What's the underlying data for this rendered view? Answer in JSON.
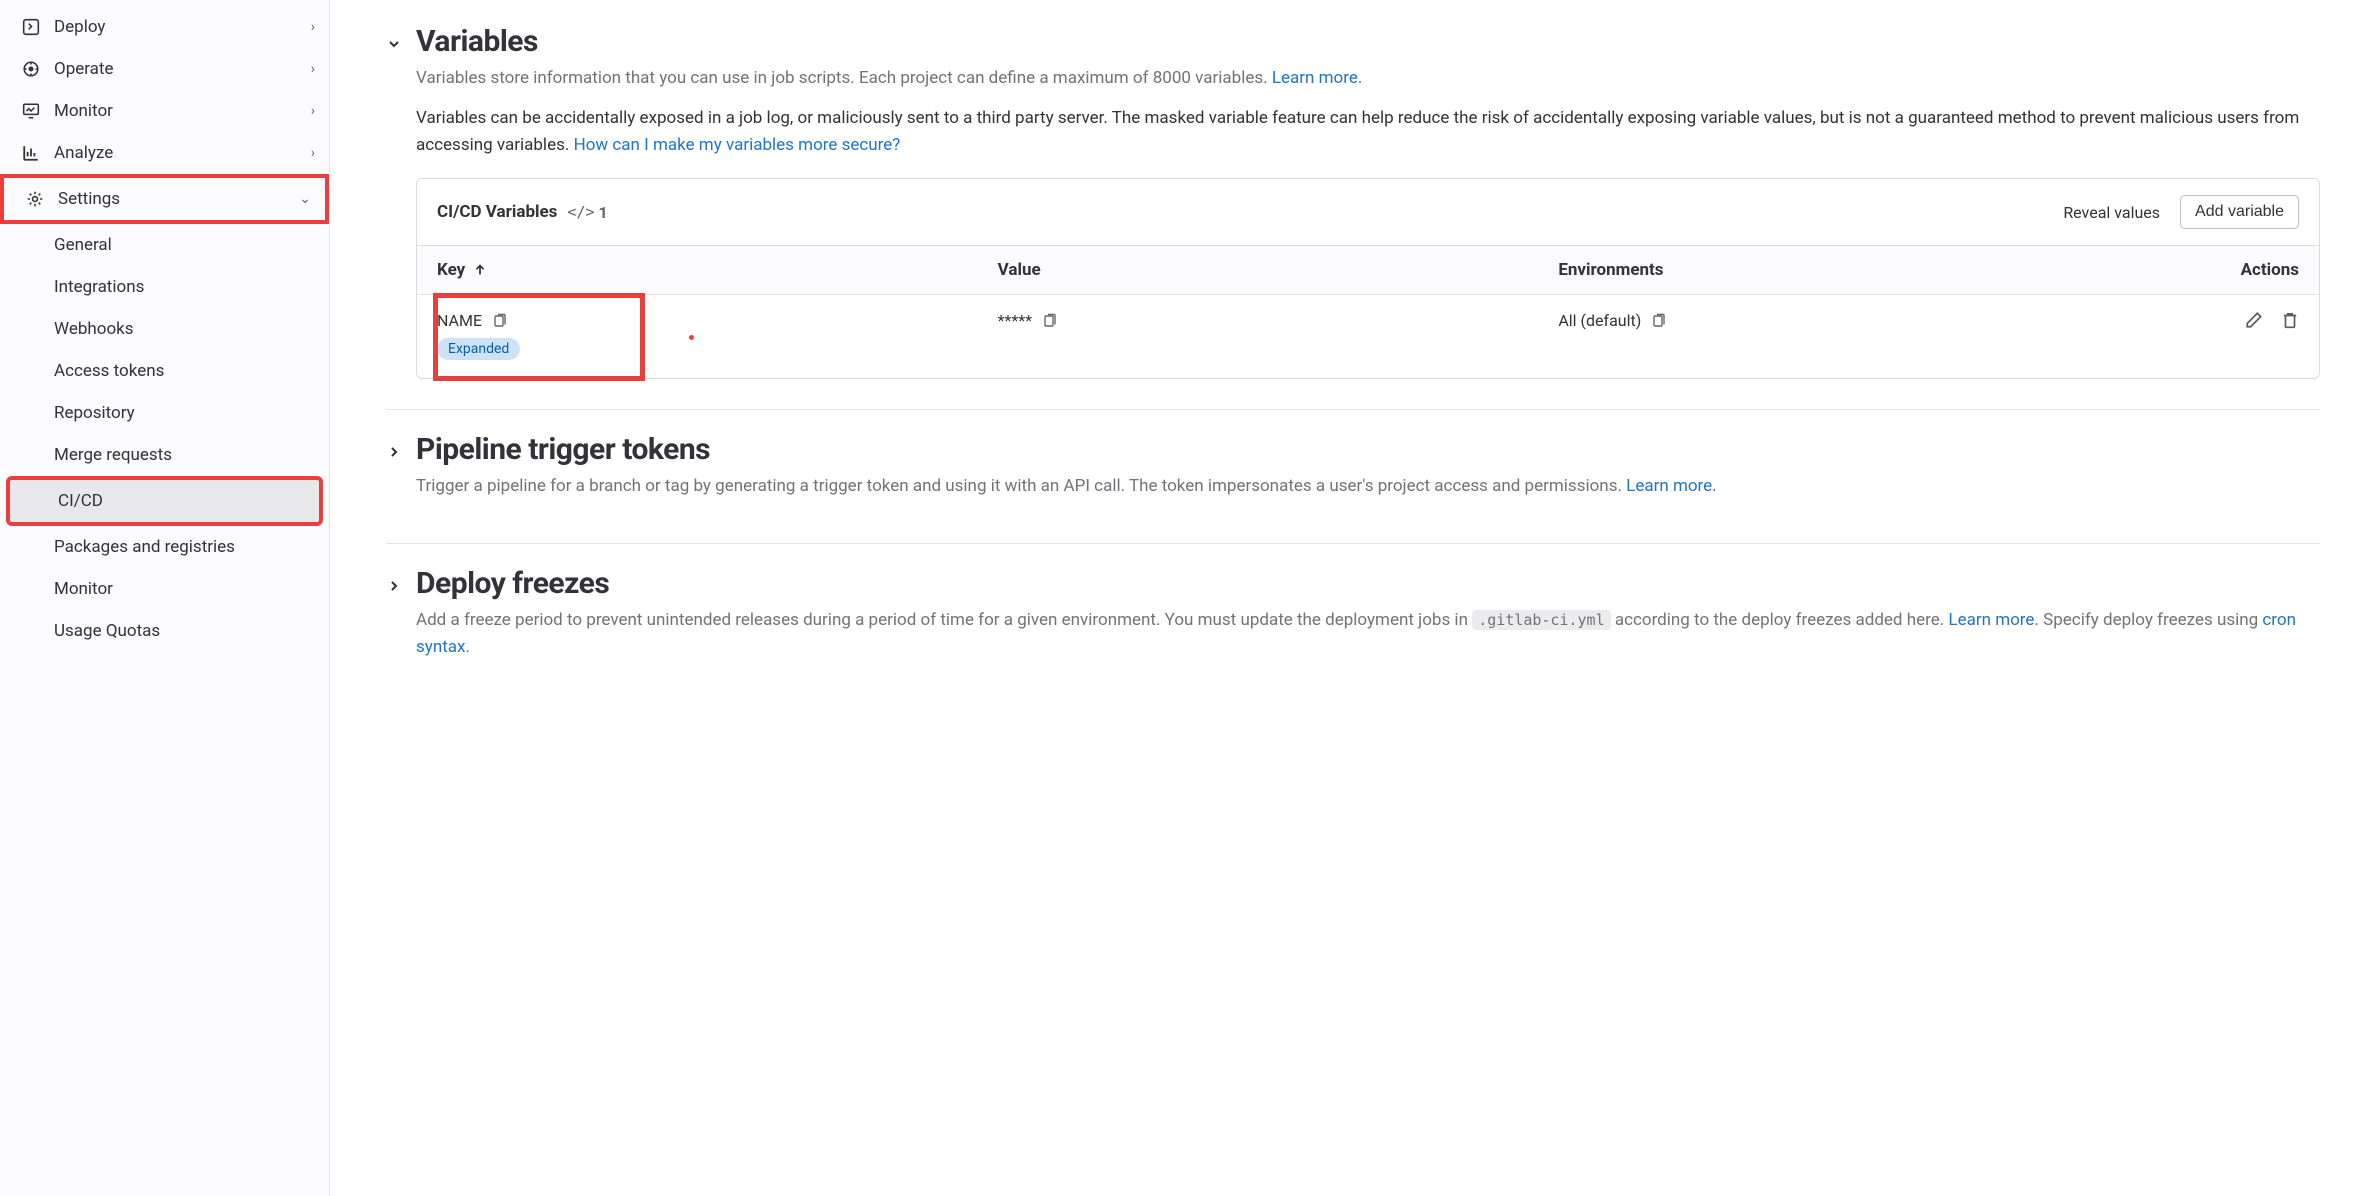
{
  "sidebar": {
    "items": [
      {
        "icon": "deploy",
        "label": "Deploy",
        "chevron": "right"
      },
      {
        "icon": "operate",
        "label": "Operate",
        "chevron": "right"
      },
      {
        "icon": "monitor",
        "label": "Monitor",
        "chevron": "right"
      },
      {
        "icon": "analyze",
        "label": "Analyze",
        "chevron": "right"
      },
      {
        "icon": "settings",
        "label": "Settings",
        "chevron": "down",
        "highlighted": true
      }
    ],
    "subitems": [
      {
        "label": "General"
      },
      {
        "label": "Integrations"
      },
      {
        "label": "Webhooks"
      },
      {
        "label": "Access tokens"
      },
      {
        "label": "Repository"
      },
      {
        "label": "Merge requests"
      },
      {
        "label": "CI/CD",
        "active": true,
        "highlighted": true
      },
      {
        "label": "Packages and registries"
      },
      {
        "label": "Monitor"
      },
      {
        "label": "Usage Quotas"
      }
    ]
  },
  "variables": {
    "heading": "Variables",
    "desc1_a": "Variables store information that you can use in job scripts. Each project can define a maximum of 8000 variables. ",
    "desc1_link": "Learn more.",
    "desc2_a": "Variables can be accidentally exposed in a job log, or maliciously sent to a third party server. The masked variable feature can help reduce the risk of accidentally exposing variable values, but is not a guaranteed method to prevent malicious users from accessing variables. ",
    "desc2_link": "How can I make my variables more secure?",
    "card_title": "CI/CD Variables",
    "count": "1",
    "reveal": "Reveal values",
    "add": "Add variable",
    "th_key": "Key",
    "th_value": "Value",
    "th_env": "Environments",
    "th_actions": "Actions",
    "row": {
      "key": "NAME",
      "badge": "Expanded",
      "value": "*****",
      "env": "All (default)"
    }
  },
  "triggers": {
    "heading": "Pipeline trigger tokens",
    "desc_a": "Trigger a pipeline for a branch or tag by generating a trigger token and using it with an API call. The token impersonates a user's project access and permissions. ",
    "desc_link": "Learn more."
  },
  "freezes": {
    "heading": "Deploy freezes",
    "desc_a": "Add a freeze period to prevent unintended releases during a period of time for a given environment. You must update the deployment jobs in ",
    "desc_code": ".gitlab-ci.yml",
    "desc_b": " according to the deploy freezes added here. ",
    "desc_link1": "Learn more.",
    "desc_c": " Specify deploy freezes using ",
    "desc_link2": "cron syntax",
    "desc_d": "."
  }
}
